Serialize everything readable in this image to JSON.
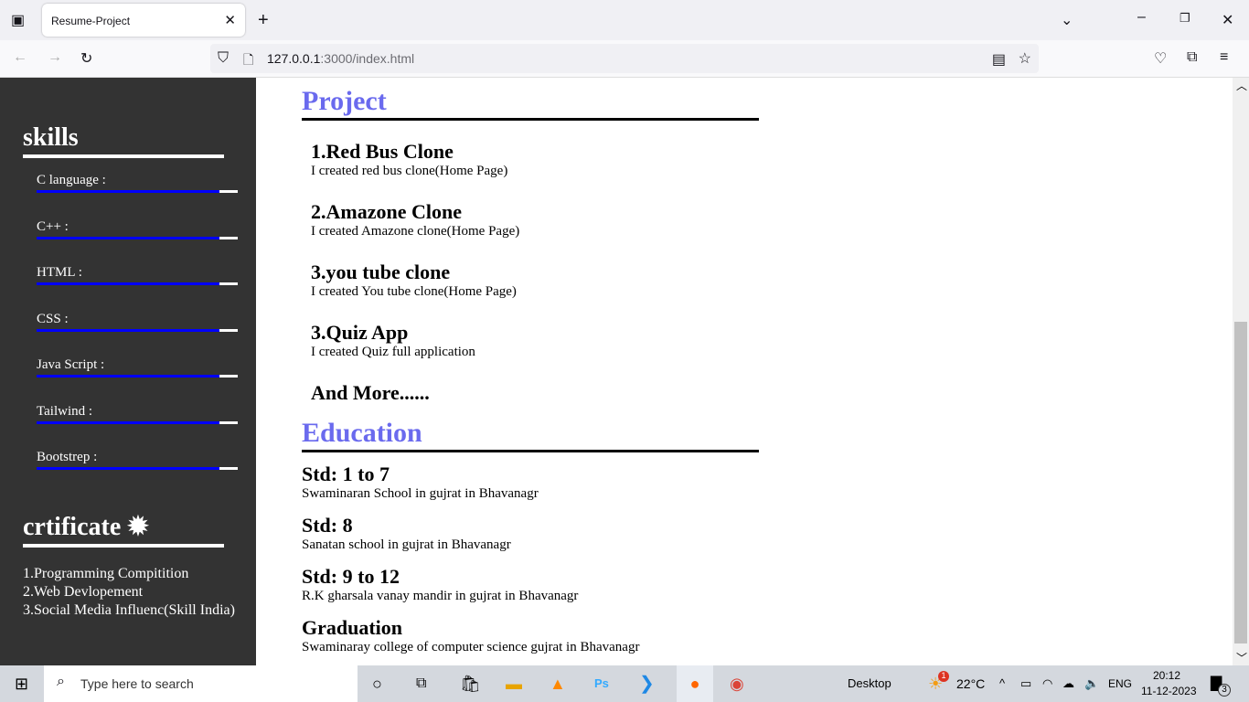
{
  "browser": {
    "tab_title": "Resume-Project",
    "url_host": "127.0.0.1",
    "url_rest": ":3000/index.html"
  },
  "sidebar": {
    "skills_title": "skills",
    "skills": [
      {
        "label": "C language :",
        "level": 0.91
      },
      {
        "label": "C++ :",
        "level": 0.91
      },
      {
        "label": "HTML :",
        "level": 0.91
      },
      {
        "label": "CSS :",
        "level": 0.91
      },
      {
        "label": "Java Script :",
        "level": 0.91
      },
      {
        "label": "Tailwind :",
        "level": 0.91
      },
      {
        "label": "Bootstrep :",
        "level": 0.91
      }
    ],
    "cert_title": "crtificate",
    "certs": [
      "1.Programming Compitition",
      "2.Web Devlopement",
      "3.Social Media Influenc(Skill India)"
    ]
  },
  "main": {
    "project_title": "Project",
    "projects": [
      {
        "title": "1.Red Bus Clone",
        "desc": "I created red bus clone(Home Page)"
      },
      {
        "title": "2.Amazone Clone",
        "desc": "I created Amazone clone(Home Page)"
      },
      {
        "title": "3.you tube clone",
        "desc": "I created You tube clone(Home Page)"
      },
      {
        "title": "3.Quiz App",
        "desc": "I created Quiz full application"
      }
    ],
    "more": "And More......",
    "education_title": "Education",
    "education": [
      {
        "title": "Std: 1 to 7",
        "desc": "Swaminaran School in gujrat in Bhavanagr"
      },
      {
        "title": "Std: 8",
        "desc": "Sanatan school in gujrat in Bhavanagr"
      },
      {
        "title": "Std: 9 to 12",
        "desc": "R.K gharsala vanay mandir in gujrat in Bhavanagr"
      },
      {
        "title": "Graduation",
        "desc": "Swaminaray college of computer science gujrat in Bhavanagr"
      }
    ]
  },
  "taskbar": {
    "search_placeholder": "Type here to search",
    "desktop": "Desktop",
    "temp": "22°C",
    "lang": "ENG",
    "time": "20:12",
    "date": "11-12-2023",
    "weather_badge": "1",
    "notif_count": "3"
  }
}
